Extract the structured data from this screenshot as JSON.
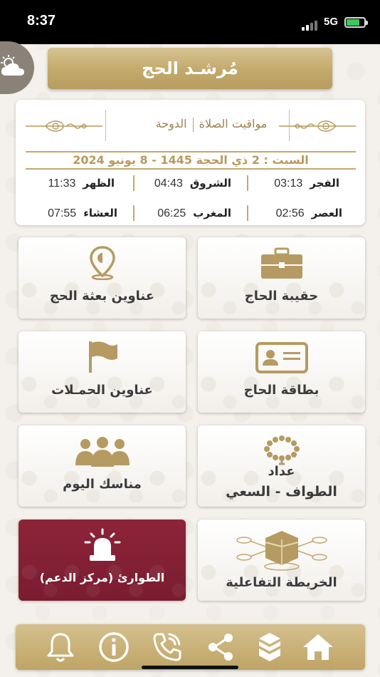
{
  "status_bar": {
    "time": "8:37",
    "network": "5G"
  },
  "header": {
    "title": "مُرشـد الحج"
  },
  "prayer_card": {
    "heading": "مواقيت الصلاة",
    "city": "الدوحة",
    "date": "السبت : 2 ذي الحجة 1445 - 8 يونيو 2024",
    "times": [
      {
        "name": "الفجر",
        "time": "03:13"
      },
      {
        "name": "الشروق",
        "time": "04:43"
      },
      {
        "name": "الظهر",
        "time": "11:33"
      },
      {
        "name": "العصر",
        "time": "02:56"
      },
      {
        "name": "المغرب",
        "time": "06:25"
      },
      {
        "name": "العشاء",
        "time": "07:55"
      }
    ]
  },
  "tiles": {
    "hajj_bag": "حقيبة الحاج",
    "mission_addresses": "عناوين بعثة الحج",
    "hajj_card": "بطاقة الحاج",
    "campaign_addresses": "عناوين الحمـلات",
    "counter_line1": "عداد",
    "counter_line2": "الطواف - السعي",
    "rituals": "مناسك اليوم",
    "interactive_map": "الخريطة التفاعلية",
    "emergency": "الطوارئ (مركز الدعم)"
  },
  "colors": {
    "gold": "#c3a86c",
    "gold_dark": "#b99a5c",
    "emergency": "#84213a",
    "text_dark": "#3b3b3b"
  },
  "icons": {
    "bottom_nav": [
      "bell-icon",
      "info-icon",
      "phone-icon",
      "share-icon",
      "kaaba-icon",
      "home-icon"
    ]
  }
}
